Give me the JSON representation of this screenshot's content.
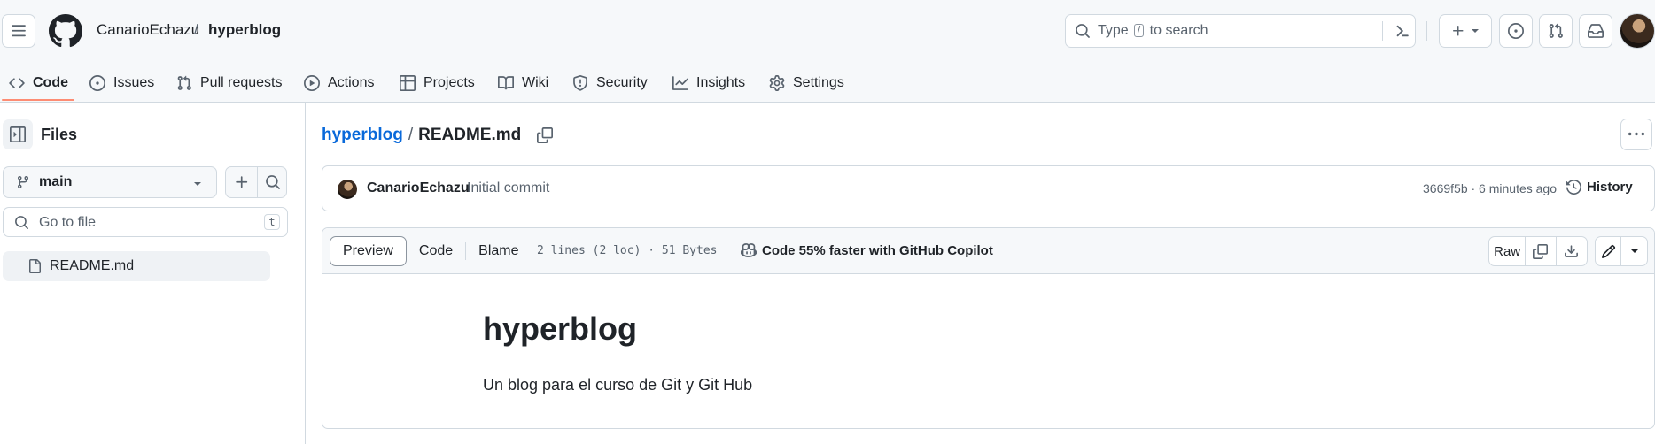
{
  "header": {
    "owner": "CanarioEchazu",
    "separator": "/",
    "repo": "hyperblog",
    "search": {
      "prefix": "Type",
      "shortcut": "/",
      "suffix": "to search"
    }
  },
  "tabs": [
    {
      "label": "Code",
      "icon": "code-icon",
      "active": true
    },
    {
      "label": "Issues",
      "icon": "issue-opened-icon"
    },
    {
      "label": "Pull requests",
      "icon": "git-pull-request-icon"
    },
    {
      "label": "Actions",
      "icon": "play-icon"
    },
    {
      "label": "Projects",
      "icon": "table-icon"
    },
    {
      "label": "Wiki",
      "icon": "book-icon"
    },
    {
      "label": "Security",
      "icon": "shield-icon"
    },
    {
      "label": "Insights",
      "icon": "graph-icon"
    },
    {
      "label": "Settings",
      "icon": "gear-icon"
    }
  ],
  "sidebar": {
    "title": "Files",
    "branch": "main",
    "goto_placeholder": "Go to file",
    "goto_shortcut": "t",
    "files": [
      {
        "name": "README.md"
      }
    ]
  },
  "main": {
    "breadcrumb_repo": "hyperblog",
    "breadcrumb_sep": "/",
    "breadcrumb_file": "README.md",
    "commit": {
      "author": "CanarioEchazu",
      "message": "Initial commit",
      "meta": "3669f5b · 6 minutes ago",
      "history_label": "History"
    },
    "viewer": {
      "modes": [
        "Preview",
        "Code",
        "Blame"
      ],
      "active_mode": "Preview",
      "stats": "2 lines (2 loc) · 51 Bytes",
      "copilot_label": "Code 55% faster with GitHub Copilot",
      "raw_label": "Raw"
    },
    "readme": {
      "title": "hyperblog",
      "body": "Un blog para el curso de Git y Git Hub"
    }
  },
  "colors": {
    "link": "#0969da",
    "active_tab_underline": "#fd8c73",
    "border": "#d1d9e0",
    "header_bg": "#f6f8fa"
  }
}
